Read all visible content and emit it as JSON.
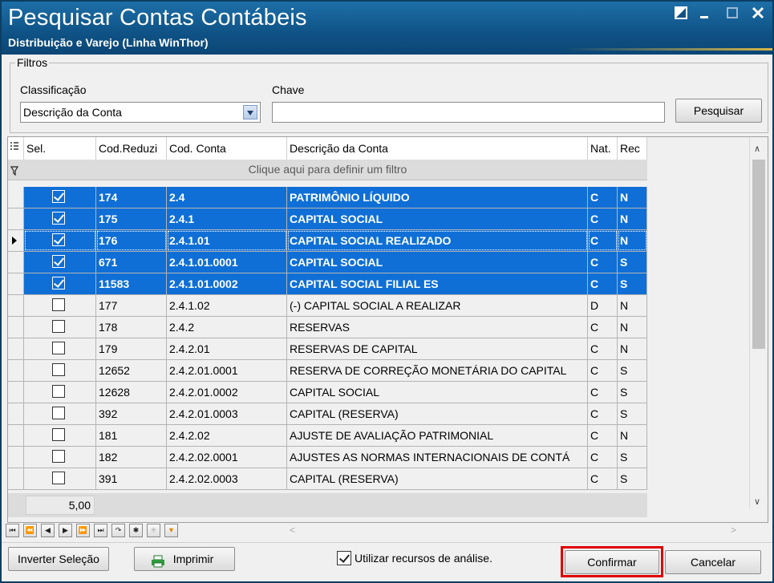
{
  "window": {
    "title": "Pesquisar Contas Contábeis",
    "subtitle": "Distribuição e Varejo (Linha WinThor)",
    "controls": [
      "restore-icon",
      "minimize-icon",
      "maximize-icon",
      "close-icon"
    ]
  },
  "filters": {
    "legend": "Filtros",
    "classificacao_label": "Classificação",
    "classificacao_value": "Descrição da Conta",
    "chave_label": "Chave",
    "chave_value": "",
    "search_button": "Pesquisar"
  },
  "grid": {
    "columns": [
      "Sel.",
      "Cod.Reduzi",
      "Cod. Conta",
      "Descrição da Conta",
      "Nat.",
      "Rec"
    ],
    "filter_hint": "Clique aqui para definir um filtro",
    "rows": [
      {
        "checked": true,
        "reduzido": "174",
        "conta": "2.4",
        "descricao": "PATRIMÔNIO LÍQUIDO",
        "nat": "C",
        "rec": "N",
        "selected": true,
        "current": false
      },
      {
        "checked": true,
        "reduzido": "175",
        "conta": "2.4.1",
        "descricao": "CAPITAL SOCIAL",
        "nat": "C",
        "rec": "N",
        "selected": true,
        "current": false
      },
      {
        "checked": true,
        "reduzido": "176",
        "conta": "2.4.1.01",
        "descricao": "CAPITAL SOCIAL REALIZADO",
        "nat": "C",
        "rec": "N",
        "selected": true,
        "current": true
      },
      {
        "checked": true,
        "reduzido": "671",
        "conta": "2.4.1.01.0001",
        "descricao": "CAPITAL SOCIAL",
        "nat": "C",
        "rec": "S",
        "selected": true,
        "current": false
      },
      {
        "checked": true,
        "reduzido": "11583",
        "conta": "2.4.1.01.0002",
        "descricao": "CAPITAL SOCIAL FILIAL ES",
        "nat": "C",
        "rec": "S",
        "selected": true,
        "current": false
      },
      {
        "checked": false,
        "reduzido": "177",
        "conta": "2.4.1.02",
        "descricao": "(-) CAPITAL SOCIAL A REALIZAR",
        "nat": "D",
        "rec": "N",
        "selected": false,
        "current": false
      },
      {
        "checked": false,
        "reduzido": "178",
        "conta": "2.4.2",
        "descricao": "RESERVAS",
        "nat": "C",
        "rec": "N",
        "selected": false,
        "current": false
      },
      {
        "checked": false,
        "reduzido": "179",
        "conta": "2.4.2.01",
        "descricao": "RESERVAS DE CAPITAL",
        "nat": "C",
        "rec": "N",
        "selected": false,
        "current": false
      },
      {
        "checked": false,
        "reduzido": "12652",
        "conta": "2.4.2.01.0001",
        "descricao": "RESERVA DE CORREÇÃO MONETÁRIA DO CAPITAL",
        "nat": "C",
        "rec": "S",
        "selected": false,
        "current": false
      },
      {
        "checked": false,
        "reduzido": "12628",
        "conta": "2.4.2.01.0002",
        "descricao": "CAPITAL SOCIAL",
        "nat": "C",
        "rec": "S",
        "selected": false,
        "current": false
      },
      {
        "checked": false,
        "reduzido": "392",
        "conta": "2.4.2.01.0003",
        "descricao": "CAPITAL (RESERVA)",
        "nat": "C",
        "rec": "S",
        "selected": false,
        "current": false
      },
      {
        "checked": false,
        "reduzido": "181",
        "conta": "2.4.2.02",
        "descricao": "AJUSTE DE AVALIAÇÃO PATRIMONIAL",
        "nat": "C",
        "rec": "N",
        "selected": false,
        "current": false
      },
      {
        "checked": false,
        "reduzido": "182",
        "conta": "2.4.2.02.0001",
        "descricao": "AJUSTES AS NORMAS INTERNACIONAIS DE CONTÁ",
        "nat": "C",
        "rec": "S",
        "selected": false,
        "current": false
      },
      {
        "checked": false,
        "reduzido": "391",
        "conta": "2.4.2.02.0003",
        "descricao": "CAPITAL (RESERVA)",
        "nat": "C",
        "rec": "S",
        "selected": false,
        "current": false
      }
    ],
    "summary_value": "5,00"
  },
  "navigator": [
    "first-icon",
    "prev-page-icon",
    "prev-icon",
    "next-icon",
    "next-page-icon",
    "last-icon",
    "refresh-icon",
    "insert-icon",
    "clear-icon",
    "filter-icon"
  ],
  "footer": {
    "invert_button": "Inverter Seleção",
    "print_button": "Imprimir",
    "analysis_checkbox_label": "Utilizar recursos de análise.",
    "analysis_checked": true,
    "confirm_button": "Confirmar",
    "cancel_button": "Cancelar"
  },
  "colors": {
    "titlebar": "#0f5285",
    "selection": "#0f6fd6",
    "confirm_highlight": "#e00000"
  }
}
